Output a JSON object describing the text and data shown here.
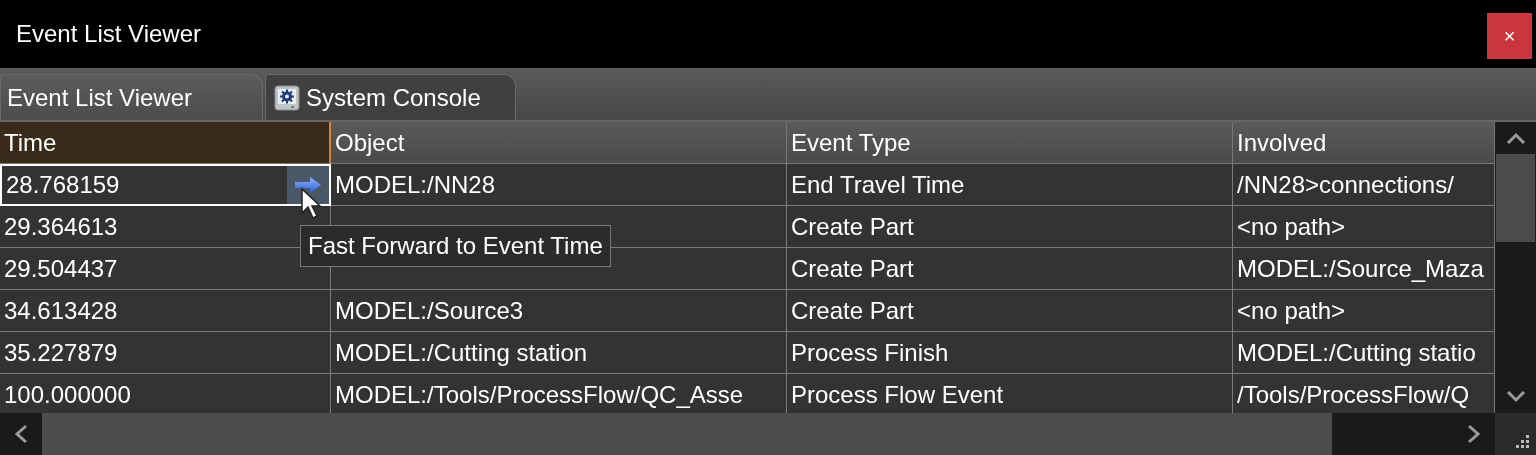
{
  "window": {
    "title": "Event List Viewer",
    "close_label": "×"
  },
  "tabs": [
    {
      "label": "Event List Viewer",
      "selected": true,
      "icon": false
    },
    {
      "label": "System Console",
      "selected": false,
      "icon": true
    }
  ],
  "table": {
    "columns": [
      {
        "label": "Time",
        "sorted": true
      },
      {
        "label": "Object",
        "sorted": false
      },
      {
        "label": "Event Type",
        "sorted": false
      },
      {
        "label": "Involved",
        "sorted": false
      }
    ],
    "rows": [
      {
        "selected": true,
        "cells": [
          "28.768159",
          "MODEL:/NN28",
          "End Travel Time",
          "/NN28>connections/"
        ]
      },
      {
        "selected": false,
        "cells": [
          "29.364613",
          null,
          "Create Part",
          "<no path>"
        ]
      },
      {
        "selected": false,
        "cells": [
          "29.504437",
          null,
          "Create Part",
          "MODEL:/Source_Maza"
        ]
      },
      {
        "selected": false,
        "cells": [
          "34.613428",
          "MODEL:/Source3",
          "Create Part",
          "<no path>"
        ]
      },
      {
        "selected": false,
        "cells": [
          "35.227879",
          "MODEL:/Cutting station",
          "Process Finish",
          "MODEL:/Cutting statio"
        ]
      },
      {
        "selected": false,
        "cells": [
          "100.000000",
          "MODEL:/Tools/ProcessFlow/QC_Asse",
          "Process Flow Event",
          "/Tools/ProcessFlow/Q"
        ]
      }
    ]
  },
  "tooltip": {
    "text": "Fast Forward to Event Time"
  }
}
